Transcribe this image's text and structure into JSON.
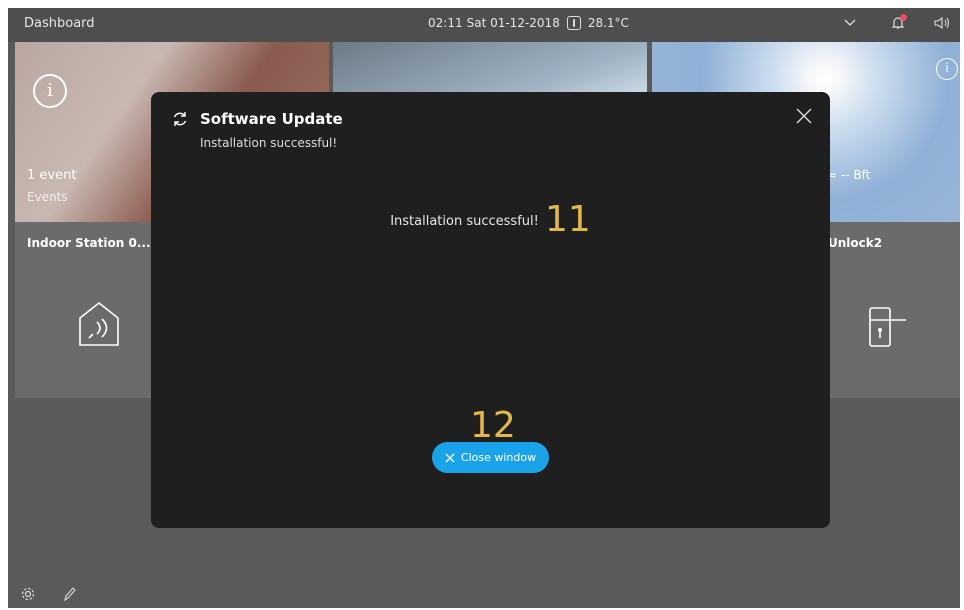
{
  "topbar": {
    "title": "Dashboard",
    "time": "02:11",
    "date": "Sat 01-12-2018",
    "temperature": "28.1°C",
    "icons": [
      "chevron-down-icon",
      "bell-icon",
      "speaker-icon"
    ]
  },
  "tiles": {
    "events": {
      "count_label": "1 event",
      "sub_label": "Events",
      "icon": "info-icon"
    },
    "weather": {
      "wind": "-- Bft",
      "icon": "info-icon"
    }
  },
  "cards": {
    "indoor_station": {
      "label": "Indoor Station 0...",
      "icon": "house-sound-icon"
    },
    "unlock": {
      "label": "Unlock2",
      "icon": "door-lock-icon"
    }
  },
  "dialog": {
    "title": "Software Update",
    "subtitle": "Installation successful!",
    "message": "Installation successful!",
    "step_a": "11",
    "step_b": "12",
    "close_button": "Close window"
  },
  "bottom": {
    "icons": [
      "gear-icon",
      "pencil-icon"
    ]
  },
  "colors": {
    "accent": "#1aa3e8",
    "step_marker": "#e3b84a",
    "notification": "#e8505b"
  }
}
